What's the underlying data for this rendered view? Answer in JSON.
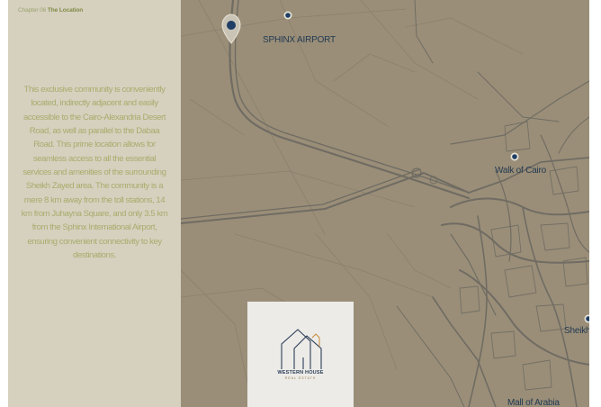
{
  "chapter": {
    "number": "Chapter 06",
    "title": "The Location"
  },
  "description": "This exclusive community is conveniently located, indirectly adjacent and easily accessible to the Cairo-Alexandria Desert Road, as well as parallel to the Dabaa Road. This prime location allows for seamless access to all the essential services and amenities of the surrounding Sheikh Zayed area. The community is a mere 8 km away from the toll stations, 14 km from Juhayna Square, and only 3.5 km from the Sphinx International Airport, ensuring convenient connectivity to key destinations.",
  "map": {
    "labels": {
      "airport": "SPHINX AIRPORT",
      "walk": "Walk of Cairo",
      "sheikh": "Sheikh",
      "mall": "Mall of Arabia"
    },
    "colors": {
      "land": "#9a8e78",
      "road": "#6f6d66",
      "pin": "#1f3f66"
    },
    "icons": [
      "location-pin-icon",
      "map-dot-icon"
    ]
  },
  "logo": {
    "name": "WESTERN HOUSE",
    "tagline": "REAL ESTATE",
    "icon": "house-outline-icon"
  },
  "colors": {
    "sidebar": "#d6d0bf",
    "text": "#a7ad6c",
    "accent": "#7f8c45"
  }
}
